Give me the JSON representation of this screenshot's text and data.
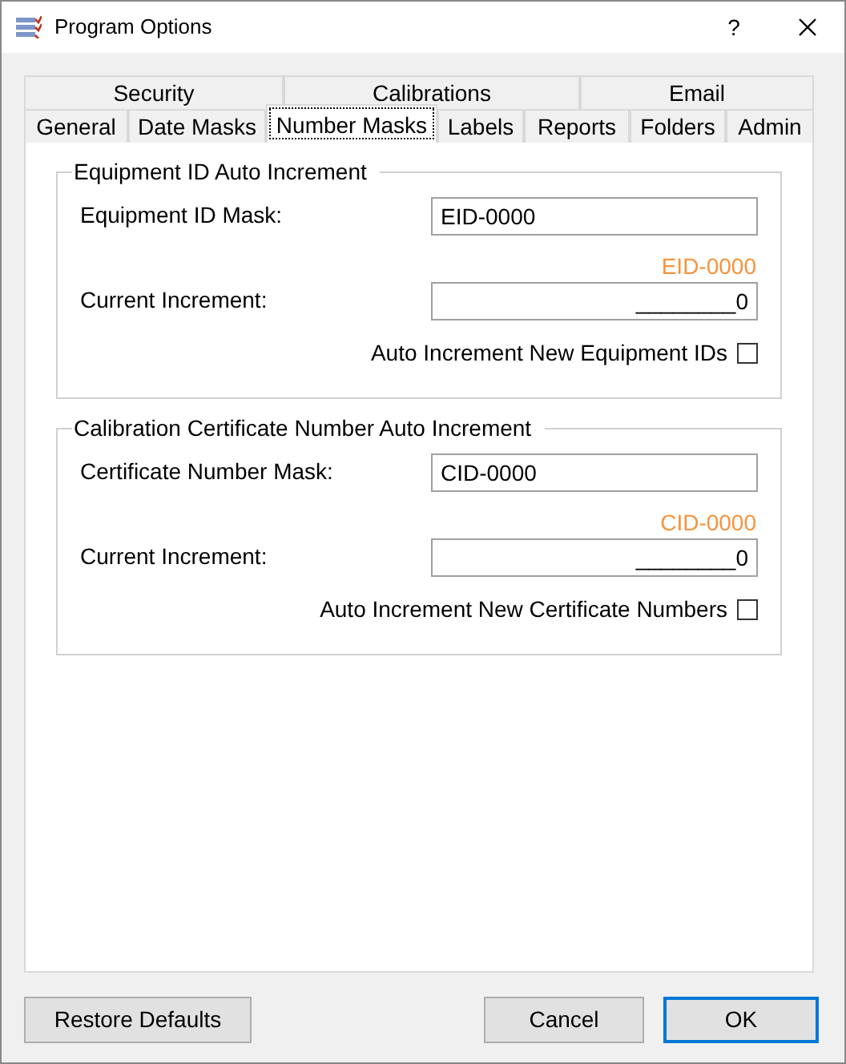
{
  "window": {
    "title": "Program Options",
    "help": "?"
  },
  "tab_rows": [
    [
      {
        "label": "Security",
        "selected": false
      },
      {
        "label": "Calibrations",
        "selected": false
      },
      {
        "label": "Email",
        "selected": false
      }
    ],
    [
      {
        "label": "General",
        "selected": false
      },
      {
        "label": "Date Masks",
        "selected": false
      },
      {
        "label": "Number Masks",
        "selected": true
      },
      {
        "label": "Labels",
        "selected": false
      },
      {
        "label": "Reports",
        "selected": false
      },
      {
        "label": "Folders",
        "selected": false
      },
      {
        "label": "Admin",
        "selected": false
      }
    ]
  ],
  "groups": [
    {
      "title": "Equipment ID Auto Increment",
      "mask_label": "Equipment ID Mask:",
      "mask_value": "EID-0000",
      "preview": "EID-0000",
      "increment_label": "Current Increment:",
      "increment_value": "________0",
      "checkbox_label": "Auto Increment New Equipment IDs",
      "checked": false
    },
    {
      "title": "Calibration Certificate Number Auto Increment",
      "mask_label": "Certificate Number Mask:",
      "mask_value": "CID-0000",
      "preview": "CID-0000",
      "increment_label": "Current Increment:",
      "increment_value": "________0",
      "checkbox_label": "Auto Increment New Certificate Numbers",
      "checked": false
    }
  ],
  "buttons": [
    {
      "label": "Restore Defaults",
      "default": false
    },
    {
      "label": "Cancel",
      "default": false
    },
    {
      "label": "OK",
      "default": true
    }
  ]
}
